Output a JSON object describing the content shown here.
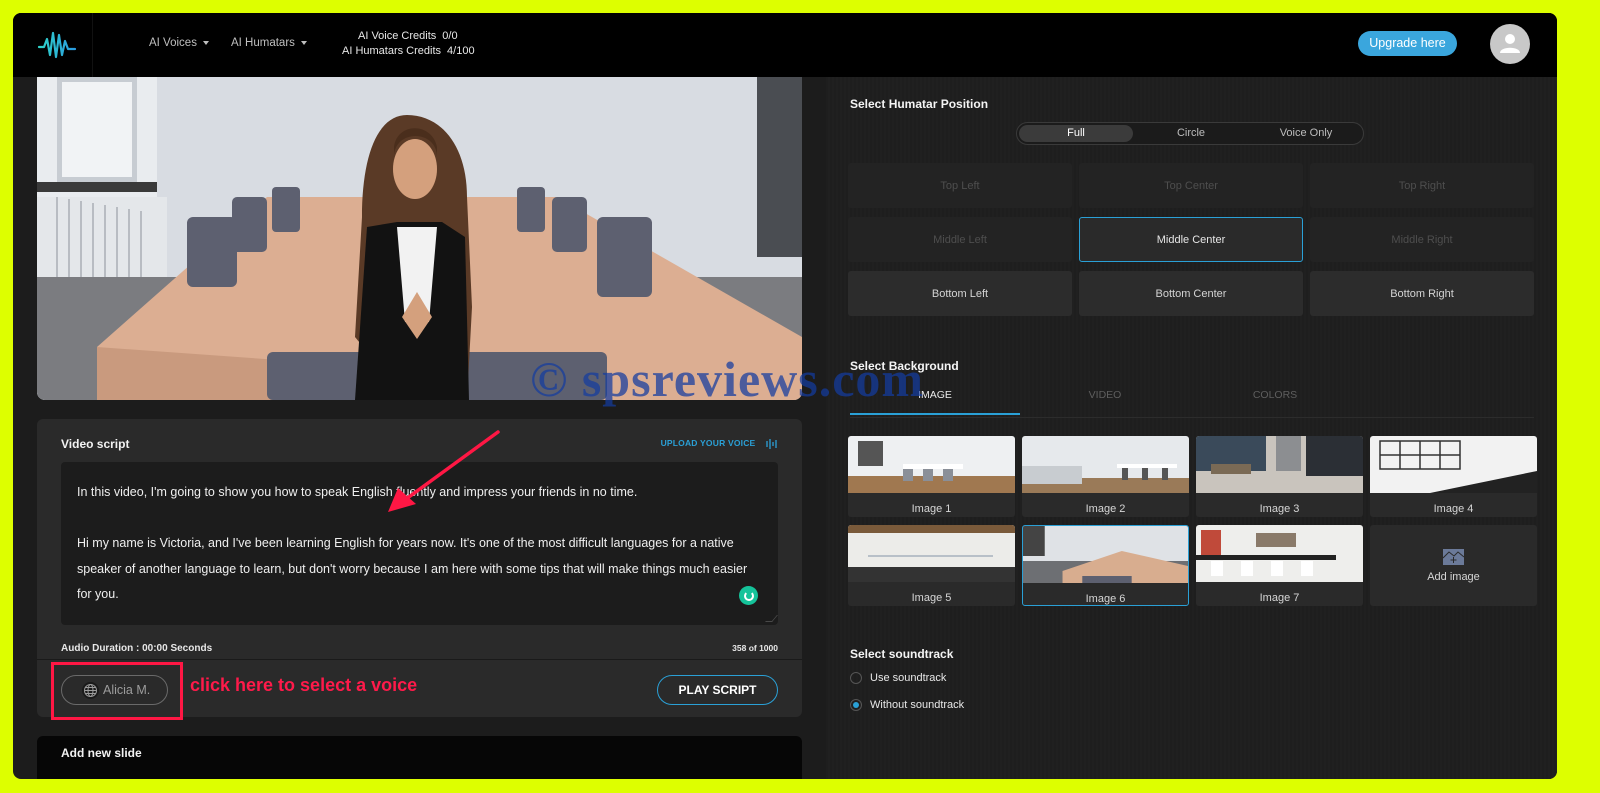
{
  "topbar": {
    "logo": "audio-wave-logo",
    "nav": [
      {
        "label": "AI Voices",
        "icon": "caret-down"
      },
      {
        "label": "AI Humatars",
        "icon": "caret-down"
      }
    ],
    "credits": [
      {
        "label": "AI Voice Credits",
        "value": "0/0"
      },
      {
        "label": "AI Humatars Credits",
        "value": "4/100"
      }
    ],
    "upgrade_label": "Upgrade here",
    "avatar_icon": "user-icon"
  },
  "preview": {
    "description": "Humatar presenter standing in conference room"
  },
  "script_panel": {
    "title": "Video script",
    "upload_label": "UPLOAD YOUR VOICE",
    "script_paragraphs": [
      "In this video, I'm going to show you how to speak English fluently and impress your friends in no time.",
      "Hi my name is Victoria, and I've been learning English for years now. It's one of the most difficult languages for a native speaker of another language to learn, but don't worry because I am here with some tips that will make things much easier for you."
    ],
    "audio_duration": "Audio Duration : 00:00 Seconds",
    "char_count": "358 of 1000",
    "voice_label": "Alicia M.",
    "play_label": "PLAY SCRIPT"
  },
  "add_slide": {
    "label": "Add new slide"
  },
  "annotation": {
    "text": "click here to select a voice",
    "color": "#ff1744"
  },
  "watermark": "© spsreviews.com",
  "position": {
    "title": "Select Humatar Position",
    "modes": [
      {
        "label": "Full",
        "active": true
      },
      {
        "label": "Circle",
        "active": false
      },
      {
        "label": "Voice Only",
        "active": false
      }
    ],
    "cells": [
      {
        "label": "Top Left",
        "state": "disabled"
      },
      {
        "label": "Top Center",
        "state": "disabled"
      },
      {
        "label": "Top Right",
        "state": "disabled"
      },
      {
        "label": "Middle Left",
        "state": "disabled"
      },
      {
        "label": "Middle Center",
        "state": "selected"
      },
      {
        "label": "Middle Right",
        "state": "disabled"
      },
      {
        "label": "Bottom Left",
        "state": "enabled"
      },
      {
        "label": "Bottom Center",
        "state": "enabled"
      },
      {
        "label": "Bottom Right",
        "state": "enabled"
      }
    ]
  },
  "background": {
    "title": "Select Background",
    "tabs": [
      {
        "label": "IMAGE",
        "active": true
      },
      {
        "label": "VIDEO",
        "active": false
      },
      {
        "label": "COLORS",
        "active": false
      }
    ],
    "images": [
      {
        "label": "Image 1",
        "selected": false
      },
      {
        "label": "Image 2",
        "selected": false
      },
      {
        "label": "Image 3",
        "selected": false
      },
      {
        "label": "Image 4",
        "selected": false
      },
      {
        "label": "Image 5",
        "selected": false
      },
      {
        "label": "Image 6",
        "selected": true
      },
      {
        "label": "Image 7",
        "selected": false
      }
    ],
    "add_label": "Add image"
  },
  "soundtrack": {
    "title": "Select soundtrack",
    "options": [
      {
        "label": "Use soundtrack",
        "checked": false
      },
      {
        "label": "Without soundtrack",
        "checked": true
      }
    ]
  },
  "colors": {
    "accent": "#2aa0d6",
    "upgrade": "#3aa6dd",
    "frame": "#ddff00"
  }
}
